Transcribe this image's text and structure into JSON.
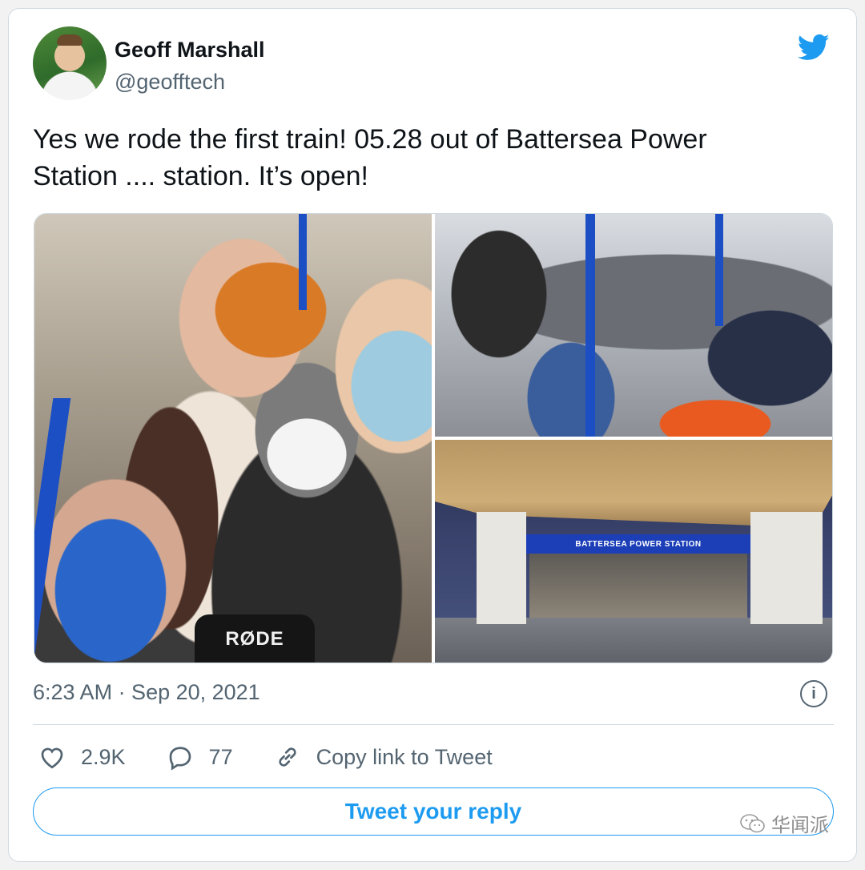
{
  "author": {
    "display_name": "Geoff Marshall",
    "handle": "@geofftech",
    "avatar_icon": "avatar-photo"
  },
  "platform_icon": "twitter-bird-icon",
  "accent_color": "#1d9bf0",
  "tweet": {
    "text_line1": "Yes we rode the first train! 05.28 out of Battersea Power",
    "text_line2": "Station .... station. It’s open!"
  },
  "media": {
    "photo_count": 3,
    "mic_label": "RØDE",
    "station_sign": "BATTERSEA POWER STATION"
  },
  "meta": {
    "timestamp": "6:23 AM · Sep 20, 2021",
    "info_icon": "info-icon"
  },
  "actions": {
    "likes": "2.9K",
    "replies": "77",
    "copy_link": "Copy link to Tweet"
  },
  "reply_button": "Tweet your reply",
  "watermark": "华闻派"
}
